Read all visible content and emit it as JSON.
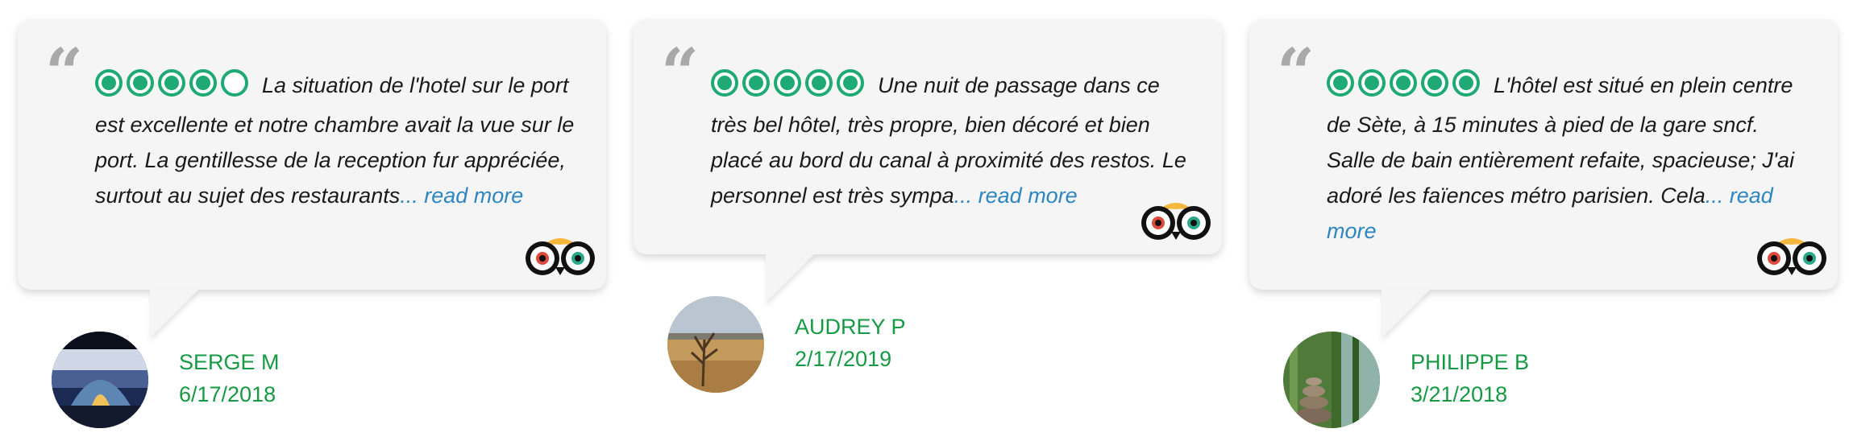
{
  "reviews": [
    {
      "rating": 4,
      "text": "La situation de l'hotel sur le port est excellente et notre chambre avait la vue sur le port. La gentillesse de la reception fur appréciée, surtout au sujet des restaurants",
      "read_more": "... read more",
      "author": "SERGE M",
      "date": "6/17/2018",
      "avatar_icon": "tent-at-dusk-photo"
    },
    {
      "rating": 5,
      "text": "Une nuit de passage dans ce très bel hôtel, très propre, bien décoré et bien placé au bord du canal à proximité des restos. Le personnel est très sympa",
      "read_more": "... read more",
      "author": "AUDREY P",
      "date": "2/17/2019",
      "avatar_icon": "savanna-landscape-photo"
    },
    {
      "rating": 5,
      "text": "L'hôtel est situé en plein centre de Sète, à 15 minutes à pied de la gare sncf. Salle de bain entièrement refaite, spacieuse; J'ai adoré les faïences métro parisien. Cela",
      "read_more": "... read more",
      "author": "PHILIPPE B",
      "date": "3/21/2018",
      "avatar_icon": "bamboo-stones-photo"
    }
  ],
  "colors": {
    "rating_green": "#1ea975",
    "author_green": "#169a43",
    "link_blue": "#2e86c1",
    "bubble_bg": "#f5f5f5",
    "quote_gray": "#a9a9a9"
  },
  "icons": {
    "quote": "open-quote-icon",
    "brand": "tripadvisor-owl-icon"
  }
}
